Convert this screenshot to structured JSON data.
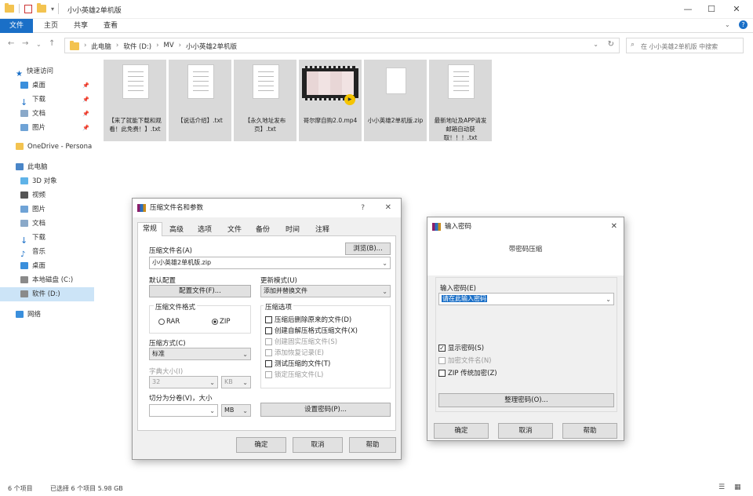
{
  "window": {
    "title": "小小英雄2单机版",
    "controls": {
      "minimize": "—",
      "maximize": "☐",
      "close": "✕"
    }
  },
  "ribbon": {
    "tabs": [
      "文件",
      "主页",
      "共享",
      "查看"
    ]
  },
  "address": {
    "crumbs": [
      "此电脑",
      "软件 (D:)",
      "MV",
      "小小英雄2单机版"
    ],
    "search_placeholder": "在 小小英雄2单机版 中搜索"
  },
  "nav": {
    "quick_access": "快速访问",
    "quick_items": [
      "桌面",
      "下载",
      "文档",
      "图片"
    ],
    "onedrive": "OneDrive - Persona",
    "this_pc": "此电脑",
    "pc_items": [
      "3D 对象",
      "视频",
      "图片",
      "文档",
      "下载",
      "音乐",
      "桌面",
      "本地磁盘 (C:)",
      "软件 (D:)"
    ],
    "network": "网络"
  },
  "files": [
    {
      "name": "【来了就能下载和观看！此免费！】.txt",
      "icon": "txt-file-icon"
    },
    {
      "name": "【说话介绍】.txt",
      "icon": "txt-file-icon"
    },
    {
      "name": "【永久地址发布页】.txt",
      "icon": "txt-file-icon"
    },
    {
      "name": "哥尔摩自购2.0.mp4",
      "icon": "video-file-icon"
    },
    {
      "name": "小小英雄2单机版.zip",
      "icon": "zip-file-icon"
    },
    {
      "name": "最新地址及APP请发邮箱自动获取！！！.txt",
      "icon": "txt-file-icon"
    }
  ],
  "status": {
    "count": "6 个项目",
    "selected": "已选择 6 个项目  5.98 GB"
  },
  "compress_dialog": {
    "title": "压缩文件名和参数",
    "help": "?",
    "close": "✕",
    "tabs": [
      "常规",
      "高级",
      "选项",
      "文件",
      "备份",
      "时间",
      "注释"
    ],
    "archive_name_label": "压缩文件名(A)",
    "browse": "浏览(B)...",
    "archive_name_value": "小小英雄2单机版.zip",
    "profile_label": "默认配置",
    "profile_button": "配置文件(F)...",
    "update_label": "更新模式(U)",
    "update_value": "添加并替换文件",
    "format_label": "压缩文件格式",
    "format_rar": "RAR",
    "format_zip": "ZIP",
    "options_label": "压缩选项",
    "options": [
      {
        "label": "压缩后删除原来的文件(D)",
        "checked": false,
        "enabled": true
      },
      {
        "label": "创建自解压格式压缩文件(X)",
        "checked": false,
        "enabled": true
      },
      {
        "label": "创建固实压缩文件(S)",
        "checked": false,
        "enabled": false
      },
      {
        "label": "添加恢复记录(E)",
        "checked": false,
        "enabled": false
      },
      {
        "label": "测试压缩的文件(T)",
        "checked": false,
        "enabled": true
      },
      {
        "label": "锁定压缩文件(L)",
        "checked": false,
        "enabled": false
      }
    ],
    "method_label": "压缩方式(C)",
    "method_value": "标准",
    "dict_label": "字典大小(I)",
    "dict_value": "32",
    "dict_unit": "KB",
    "split_label": "切分为分卷(V)，大小",
    "split_unit": "MB",
    "password_button": "设置密码(P)...",
    "ok": "确定",
    "cancel": "取消",
    "help_button": "帮助"
  },
  "password_dialog": {
    "title": "输入密码",
    "close": "✕",
    "header": "带密码压缩",
    "input_label": "输入密码(E)",
    "input_value": "请在此输入密码",
    "show_password": "显示密码(S)",
    "encrypt_names": "加密文件名(N)",
    "zip_legacy": "ZIP 传统加密(Z)",
    "organize": "整理密码(O)...",
    "ok": "确定",
    "cancel": "取消",
    "help": "帮助"
  },
  "colors": {
    "accent": "#1a6fc7",
    "selection": "#cce4f7",
    "file_selected": "#d9d9d9"
  }
}
